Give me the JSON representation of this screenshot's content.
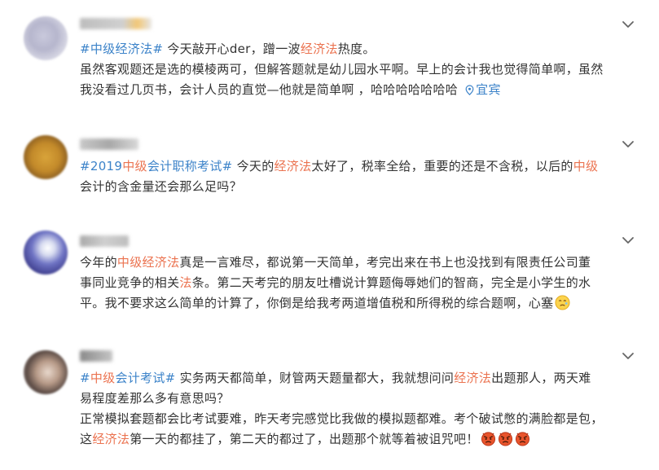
{
  "comments": [
    {
      "lines": [
        [
          [
            "hashtag",
            "#中级经济法#"
          ],
          [
            "text",
            " 今天敲开心der，蹭一波"
          ],
          [
            "tag",
            "经济法"
          ],
          [
            "text",
            "热度。"
          ]
        ],
        [
          [
            "text",
            "虽然客观题还是选的模棱两可，但解答题就是幼儿园水平啊。早上的会计我也觉得简单啊，虽然"
          ]
        ],
        [
          [
            "text",
            "我没看过几页书，会计人员的直觉—他就是简单啊 ，哈哈哈哈哈哈哈 "
          ]
        ]
      ],
      "location": "宜宾"
    },
    {
      "lines": [
        [
          [
            "hashtag",
            "#2019"
          ],
          [
            "tag",
            "中级"
          ],
          [
            "hashtag",
            "会计职称考试#"
          ],
          [
            "text",
            " 今天的"
          ],
          [
            "tag",
            "经济法"
          ],
          [
            "text",
            "太好了，税率全给，重要的还是不含税，以后的"
          ],
          [
            "tag",
            "中级"
          ]
        ],
        [
          [
            "text",
            "会计的含金量还会那么足吗？"
          ]
        ]
      ]
    },
    {
      "lines": [
        [
          [
            "text",
            "今年的"
          ],
          [
            "tag",
            "中级经济法"
          ],
          [
            "text",
            "真是一言难尽，都说第一天简单，考完出来在书上也没找到有限责任公司董"
          ]
        ],
        [
          [
            "text",
            "事同业竞争的相关"
          ],
          [
            "tag",
            "法"
          ],
          [
            "text",
            "条。第二天考完的朋友吐槽说计算题侮辱她们的智商，完全是小学生的水"
          ]
        ],
        [
          [
            "text",
            "平。我不要求这么简单的计算了，你倒是给我考两道增值税和所得税的综合题啊，心塞"
          ]
        ]
      ],
      "emoji": [
        "sad-face"
      ]
    },
    {
      "lines": [
        [
          [
            "hashtag",
            "#"
          ],
          [
            "tag",
            "中级"
          ],
          [
            "hashtag",
            "会计考试#"
          ],
          [
            "text",
            " 实务两天都简单，财管两天题量都大，我就想问问"
          ],
          [
            "tag",
            "经济法"
          ],
          [
            "text",
            "出题那人，两天难"
          ]
        ],
        [
          [
            "text",
            "易程度差那么多有意思吗？"
          ]
        ],
        [
          [
            "text",
            "正常模拟套题都会比考试要难，昨天考完感觉比我做的模拟题都难。考个破试憋的满脸都是包，"
          ]
        ],
        [
          [
            "text",
            "这"
          ],
          [
            "tag",
            "经济法"
          ],
          [
            "text",
            "第一天的都挂了，第二天的都过了，出题那个就等着被诅咒吧！"
          ]
        ]
      ],
      "emoji": [
        "angry-face",
        "angry-face",
        "angry-face"
      ]
    }
  ],
  "colors": {
    "hashtag": "#3c83c9",
    "keyword": "#eb7350",
    "text": "#333333",
    "chevron": "#666666"
  },
  "icons": {
    "expand": "chevron-down-icon",
    "location": "location-pin-icon"
  }
}
